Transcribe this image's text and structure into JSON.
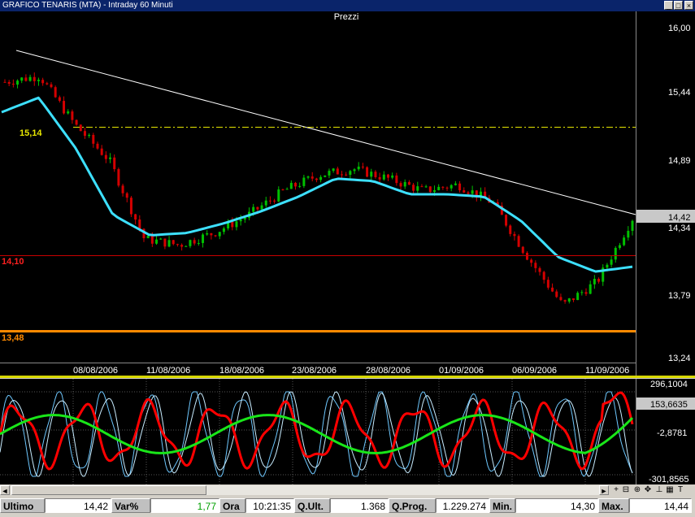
{
  "window": {
    "title": "GRAFICO TENARIS (MTA) - Intraday 60 Minuti"
  },
  "price_panel": {
    "title": "Prezzi",
    "y_ticks": [
      "16,00",
      "15,44",
      "14,89",
      "14,34",
      "13,79",
      "13,24"
    ],
    "dates": [
      "08/08/2006",
      "11/08/2006",
      "18/08/2006",
      "23/08/2006",
      "28/08/2006",
      "01/09/2006",
      "06/09/2006",
      "11/09/2006"
    ],
    "current_price": "14,42",
    "level_low": "13,48",
    "level_support": "14,10",
    "level_dash": "15,14"
  },
  "oscillator_panel": {
    "y_ticks": [
      "296,1004",
      "-2,8781",
      "-301,8565"
    ],
    "current_value": "153,6635"
  },
  "colors": {
    "background": "#000000",
    "bull_candle": "#00c000",
    "bear_candle": "#d40000",
    "moving_average": "#3de0ff",
    "trendline": "#ffffff",
    "support": "#c80000",
    "low_level": "#ff8a00",
    "dash_level": "#e6e600",
    "osc_fast": "#ff0000",
    "osc_slow": "#19e619",
    "osc_thin": "#6ec8ff"
  },
  "status": {
    "ultimo_label": "Ultimo",
    "ultimo": "14,42",
    "var_label": "Var%",
    "var": "1,77",
    "ora_label": "Ora",
    "ora": "10:21:35",
    "qult_label": "Q.Ult.",
    "qult": "1.368",
    "qprog_label": "Q.Prog.",
    "qprog": "1.229.274",
    "min_label": "Min.",
    "min": "14,30",
    "max_label": "Max.",
    "max": "14,44"
  },
  "chart_data": {
    "type": "line",
    "title": "Prezzi",
    "x": [
      "08/08/2006",
      "11/08/2006",
      "18/08/2006",
      "23/08/2006",
      "28/08/2006",
      "01/09/2006",
      "06/09/2006",
      "11/09/2006"
    ],
    "ylim": [
      13.24,
      16.0
    ],
    "series": [
      {
        "values": [
          15.55,
          15.6,
          15.2,
          14.9,
          14.25,
          14.2,
          14.3,
          14.45,
          14.65,
          14.78,
          14.83,
          14.75,
          14.65,
          14.7,
          14.55,
          14.1,
          13.7,
          13.9,
          14.42
        ]
      },
      {
        "values": [
          15.3,
          15.42,
          15.0,
          14.45,
          14.28,
          14.3,
          14.38,
          14.48,
          14.6,
          14.75,
          14.73,
          14.62,
          14.62,
          14.6,
          14.4,
          14.1,
          13.98,
          14.02
        ]
      }
    ],
    "annotations": [
      "15,14",
      "14,10",
      "13,48"
    ],
    "oscillator_range": [
      -301.8565,
      296.1004
    ]
  }
}
